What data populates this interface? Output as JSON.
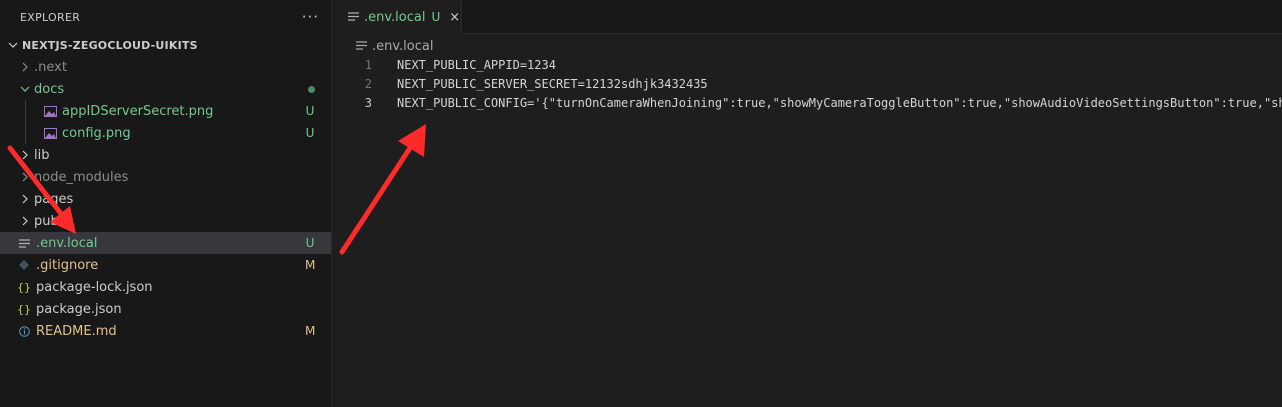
{
  "explorer": {
    "title": "EXPLORER",
    "more": "···",
    "project": "NEXTJS-ZEGOCLOUD-UIKITS",
    "items": [
      {
        "label": ".next",
        "badge": ""
      },
      {
        "label": "docs",
        "badge": ""
      },
      {
        "label": "appIDServerSecret.png",
        "badge": "U"
      },
      {
        "label": "config.png",
        "badge": "U"
      },
      {
        "label": "lib",
        "badge": ""
      },
      {
        "label": "node_modules",
        "badge": ""
      },
      {
        "label": "pages",
        "badge": ""
      },
      {
        "label": "public",
        "badge": ""
      },
      {
        "label": ".env.local",
        "badge": "U"
      },
      {
        "label": ".gitignore",
        "badge": "M"
      },
      {
        "label": "package-lock.json",
        "badge": ""
      },
      {
        "label": "package.json",
        "badge": ""
      },
      {
        "label": "README.md",
        "badge": "M"
      }
    ]
  },
  "tab": {
    "name": ".env.local",
    "badge": "U",
    "close": "×"
  },
  "breadcrumb": ".env.local",
  "editor": {
    "lines": [
      {
        "num": "1",
        "text": "NEXT_PUBLIC_APPID=1234"
      },
      {
        "num": "2",
        "text": "NEXT_PUBLIC_SERVER_SECRET=12132sdhjk3432435"
      },
      {
        "num": "3",
        "text": "NEXT_PUBLIC_CONFIG='{\"turnOnCameraWhenJoining\":true,\"showMyCameraToggleButton\":true,\"showAudioVideoSettingsButton\":true,\"sh"
      }
    ]
  },
  "colors": {
    "untracked": "#73c991",
    "modified": "#e2c08d",
    "annotation": "#ff2a2a"
  }
}
